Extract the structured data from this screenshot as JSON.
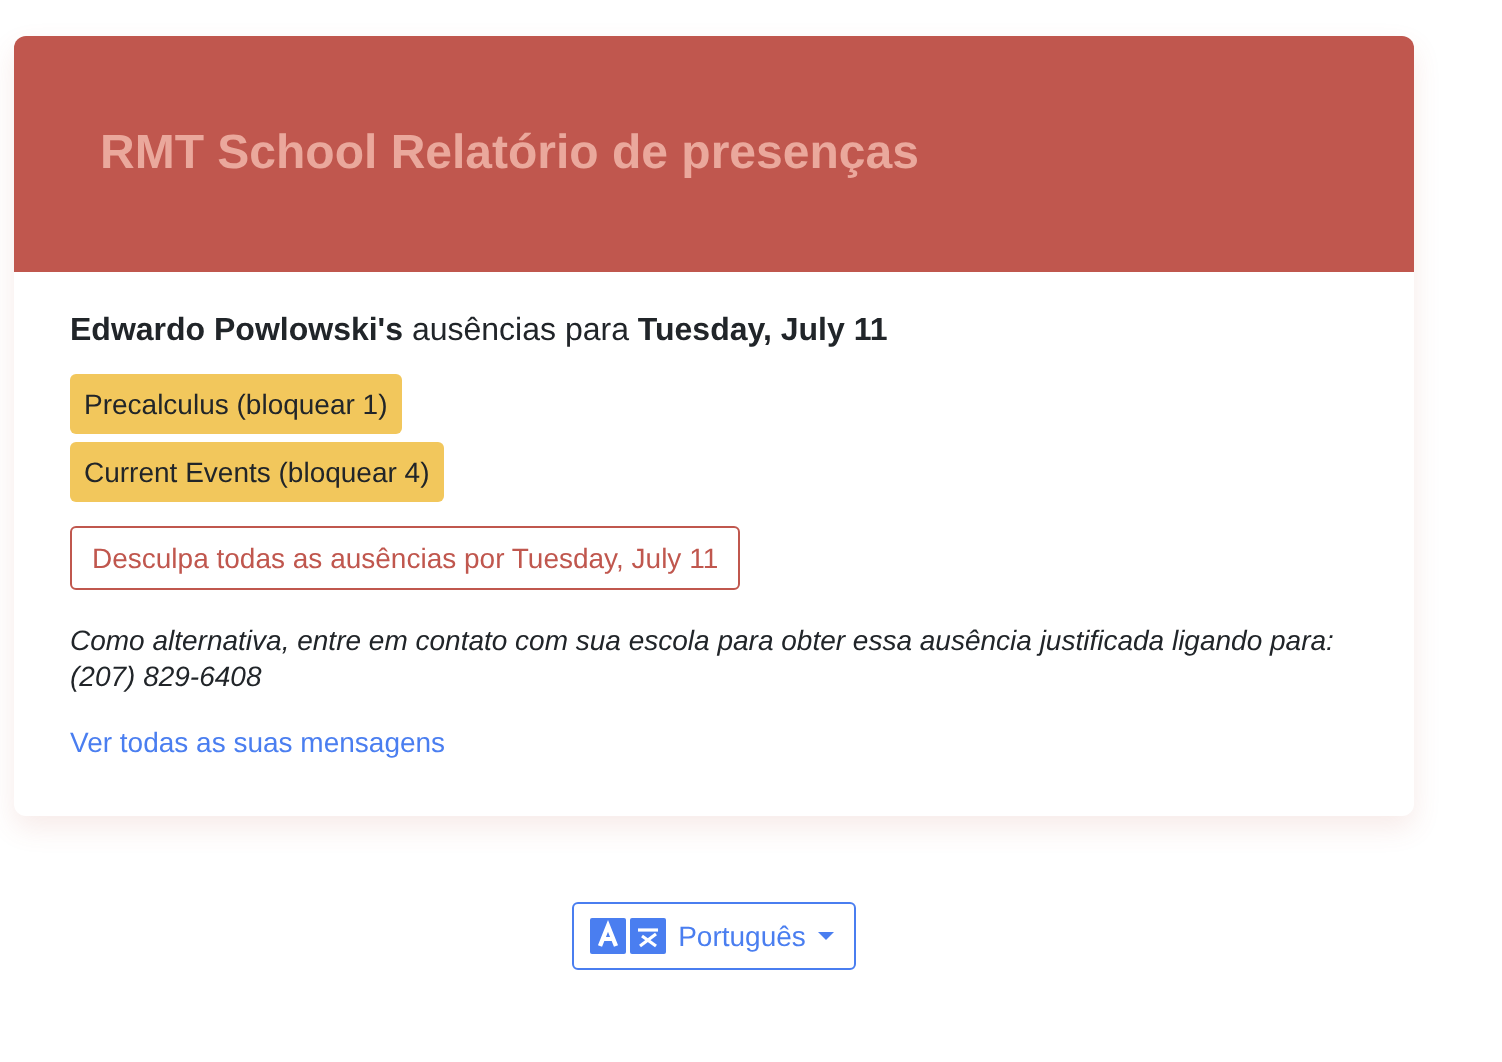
{
  "header": {
    "title": "RMT School Relatório de presenças"
  },
  "heading": "**Edwardo Powlowski's** ausências para **Tuesday, July 11**",
  "absences": [
    {
      "label": "Precalculus (bloquear 1)"
    },
    {
      "label": "Current Events (bloquear 4)"
    }
  ],
  "excuse_button": "Desculpa todas as ausências por Tuesday, July 11",
  "note": "Como alternativa, entre em contato com sua escola para obter essa ausência justificada ligando para: (207) 829-6408",
  "messages_link": "Ver todas as suas mensagens",
  "language_button": {
    "label": "Português"
  }
}
